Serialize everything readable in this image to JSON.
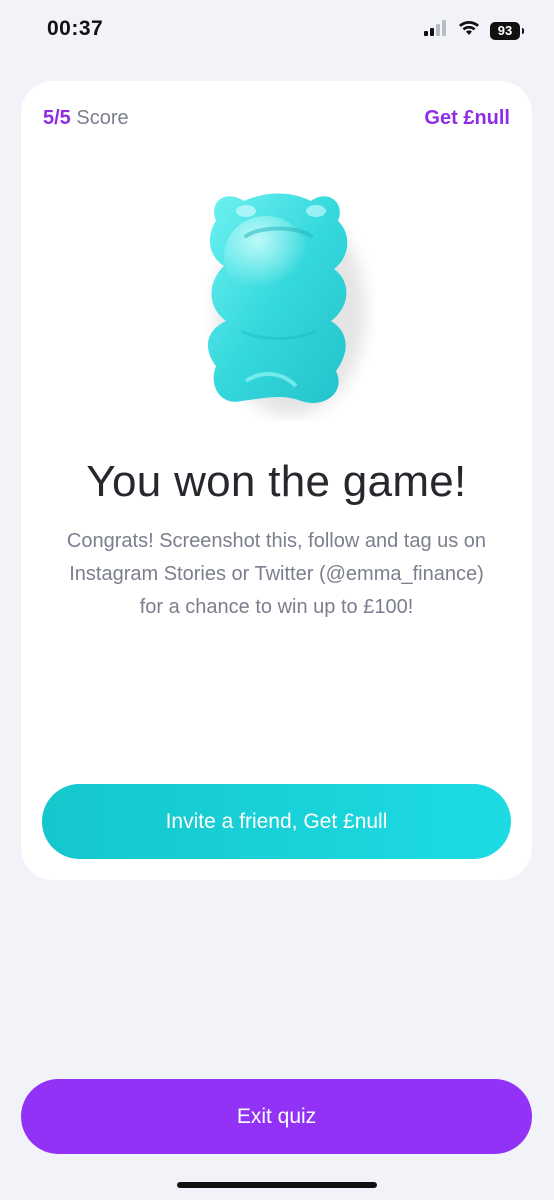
{
  "status_bar": {
    "time": "00:37",
    "battery": "93",
    "icons": [
      "signal-icon",
      "wifi-icon",
      "battery-icon"
    ]
  },
  "quiz": {
    "score_value": "5/5",
    "score_label": "Score",
    "reward_link": "Get £null",
    "illustration": "gummy-bear",
    "title": "You won the game!",
    "message": "Congrats! Screenshot this, follow and tag us on Instagram Stories or Twitter (@emma_finance) for a chance to win up to £100!",
    "invite_button": "Invite a friend, Get £null"
  },
  "footer": {
    "exit_button": "Exit quiz"
  },
  "colors": {
    "background": "#f2f3f8",
    "accent_purple": "#9332f7",
    "accent_teal": "#1ad2da",
    "title_text": "#26282d",
    "muted_text": "#7b7f8d"
  }
}
